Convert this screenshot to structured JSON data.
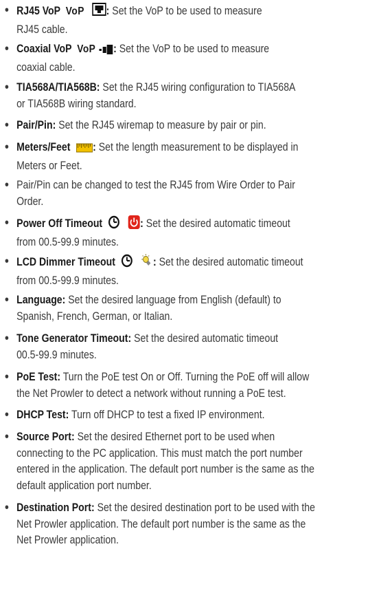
{
  "items": [
    {
      "term": "RJ45 VoP",
      "icon_text": "VoP",
      "icons": [
        "vop-label",
        "rj45-port-icon"
      ],
      "after": "Set the VoP to be used to measure",
      "cont": [
        "RJ45 cable."
      ]
    },
    {
      "term": "Coaxial VoP",
      "icon_text": "VoP",
      "icons": [
        "vop-label",
        "coaxial-connector-icon"
      ],
      "after": "Set the VoP to be used to measure",
      "cont": [
        "coaxial cable."
      ]
    },
    {
      "term": "TIA568A/TIA568B:",
      "after": "Set the RJ45 wiring configuration to TIA568A",
      "cont": [
        "or TIA568B wiring standard."
      ]
    },
    {
      "term": "Pair/Pin:",
      "after": "Set the RJ45 wiremap to measure by pair or pin.",
      "cont": []
    },
    {
      "term": "Meters/Feet",
      "icons": [
        "ruler-icon"
      ],
      "after": "Set the length measurement to be displayed in",
      "cont": [
        "Meters or Feet."
      ]
    },
    {
      "term": "",
      "after": "Pair/Pin can be changed to test the RJ45 from Wire Order to Pair",
      "cont": [
        "Order."
      ]
    },
    {
      "term": "Power Off Timeout",
      "icons": [
        "clock-icon",
        "power-icon"
      ],
      "after": "Set the desired automatic timeout",
      "cont": [
        "from 00.5-99.9 minutes."
      ]
    },
    {
      "term": "LCD Dimmer Timeout",
      "icons": [
        "clock-icon",
        "lightbulb-icon"
      ],
      "after": "Set the desired automatic timeout",
      "cont": [
        "from 00.5-99.9 minutes."
      ]
    },
    {
      "term": "Language:",
      "after": "Set the desired language from English (default) to",
      "cont": [
        "Spanish, French, German, or Italian."
      ]
    },
    {
      "term": "Tone Generator Timeout:",
      "after": "Set the desired automatic timeout",
      "cont": [
        "00.5-99.9 minutes."
      ]
    },
    {
      "term": "PoE Test:",
      "after": "Turn the PoE test On or Off. Turning the PoE off will allow",
      "cont": [
        "the Net Prowler to detect a network without running a PoE test."
      ]
    },
    {
      "term": "DHCP Test:",
      "after": "Turn off DHCP to test a fixed IP environment.",
      "cont": []
    },
    {
      "term": "Source Port:",
      "after": "Set the desired Ethernet port to be used when",
      "cont": [
        "connecting to the PC application. This must match the port number",
        "entered in the application. The default port number is the same as the",
        "default application port number."
      ]
    },
    {
      "term": "Destination Port:",
      "after": "Set the desired destination port to be used with the",
      "cont": [
        "Net Prowler application. The default port number is the same as the",
        "Net Prowler application."
      ]
    }
  ],
  "colors": {
    "text": "#3a3a3a",
    "power_red": "#e0251b",
    "ruler_yellow": "#f2c100",
    "bulb_yellow": "#e8b400"
  }
}
